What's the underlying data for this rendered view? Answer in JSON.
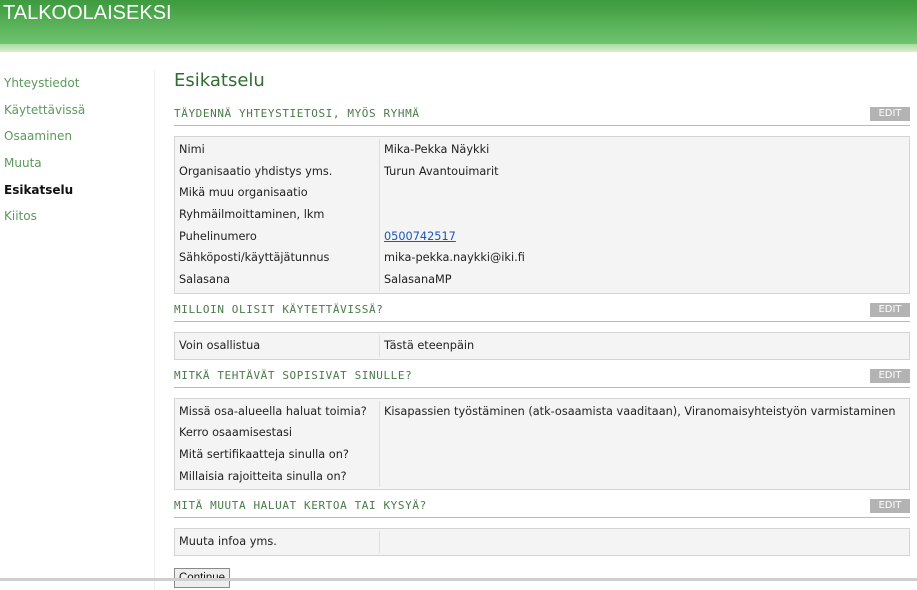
{
  "header": {
    "title": "TALKOOLAISEKSI"
  },
  "sidebar": {
    "items": [
      {
        "label": "Yhteystiedot"
      },
      {
        "label": "Käytettävissä"
      },
      {
        "label": "Osaaminen"
      },
      {
        "label": "Muuta"
      },
      {
        "label": "Esikatselu"
      },
      {
        "label": "Kiitos"
      }
    ]
  },
  "main": {
    "title": "Esikatselu",
    "edit_label": "EDIT",
    "continue_label": "Continue",
    "sections": [
      {
        "title": "TÄYDENNÄ YHTEYSTIETOSI, MYÖS RYHMÄ",
        "rows": [
          {
            "label": "Nimi",
            "value": "Mika-Pekka Näykki"
          },
          {
            "label": "Organisaatio yhdistys yms.",
            "value": "Turun Avantouimarit"
          },
          {
            "label": "Mikä muu organisaatio",
            "value": ""
          },
          {
            "label": "Ryhmäilmoittaminen, lkm",
            "value": ""
          },
          {
            "label": "Puhelinumero",
            "value": "0500742517"
          },
          {
            "label": "Sähköposti/käyttäjätunnus",
            "value": "mika-pekka.naykki@iki.fi"
          },
          {
            "label": "Salasana",
            "value": "SalasanaMP"
          }
        ]
      },
      {
        "title": "MILLOIN OLISIT KÄYTETTÄVISSÄ?",
        "rows": [
          {
            "label": "Voin osallistua",
            "value": "Tästä eteenpäin"
          }
        ]
      },
      {
        "title": "MITKÄ TEHTÄVÄT SOPISIVAT SINULLE?",
        "rows": [
          {
            "label": "Missä osa-alueella haluat toimia?",
            "value": "Kisapassien työstäminen (atk-osaamista vaaditaan), Viranomaisyhteistyön varmistaminen"
          },
          {
            "label": "Kerro osaamisestasi",
            "value": ""
          },
          {
            "label": "Mitä sertifikaatteja sinulla on?",
            "value": ""
          },
          {
            "label": "Millaisia rajoitteita sinulla on?",
            "value": ""
          }
        ]
      },
      {
        "title": "MITÄ MUUTA HALUAT KERTOA TAI KYSYÄ?",
        "rows": [
          {
            "label": "Muuta infoa yms.",
            "value": ""
          }
        ]
      }
    ]
  }
}
